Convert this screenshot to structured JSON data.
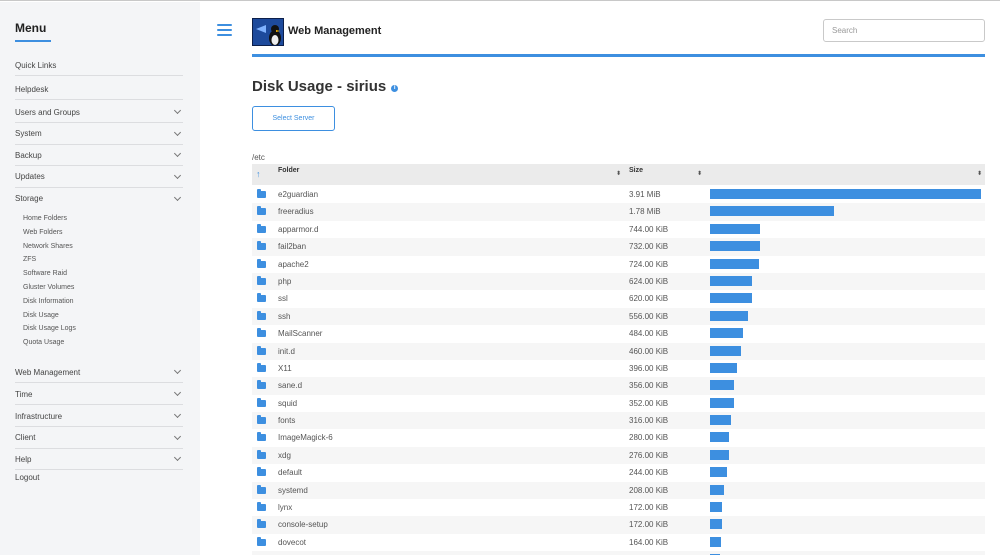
{
  "sidebar": {
    "title": "Menu",
    "items": [
      {
        "label": "Quick Links",
        "expandable": false
      },
      {
        "label": "Helpdesk",
        "expandable": false
      },
      {
        "label": "Users and Groups",
        "expandable": true
      },
      {
        "label": "System",
        "expandable": true
      },
      {
        "label": "Backup",
        "expandable": true
      },
      {
        "label": "Updates",
        "expandable": true
      },
      {
        "label": "Storage",
        "expandable": true
      }
    ],
    "storage_sub": [
      "Home Folders",
      "Web Folders",
      "Network Shares",
      "ZFS",
      "Software Raid",
      "Gluster Volumes",
      "Disk Information",
      "Disk Usage",
      "Disk Usage Logs",
      "Quota Usage"
    ],
    "items_after": [
      {
        "label": "Web Management",
        "expandable": true
      },
      {
        "label": "Time",
        "expandable": true
      },
      {
        "label": "Infrastructure",
        "expandable": true
      },
      {
        "label": "Client",
        "expandable": true
      },
      {
        "label": "Help",
        "expandable": true
      },
      {
        "label": "Logout",
        "expandable": false
      }
    ]
  },
  "header": {
    "brand": "Web Management",
    "search_placeholder": "Search"
  },
  "main": {
    "title": "Disk Usage - sirius",
    "info_icon": "i",
    "select_button": "Select Server",
    "path": "/etc",
    "columns": {
      "folder": "Folder",
      "size": "Size",
      "sort_icon": "↑",
      "sort_both": "⬍"
    },
    "bar_color": "#3d8fe0",
    "rows": [
      {
        "name": "e2guardian",
        "size": "3.91 MiB",
        "fraction": 1.0
      },
      {
        "name": "freeradius",
        "size": "1.78 MiB",
        "fraction": 0.456
      },
      {
        "name": "apparmor.d",
        "size": "744.00 KiB",
        "fraction": 0.186
      },
      {
        "name": "fail2ban",
        "size": "732.00 KiB",
        "fraction": 0.183
      },
      {
        "name": "apache2",
        "size": "724.00 KiB",
        "fraction": 0.181
      },
      {
        "name": "php",
        "size": "624.00 KiB",
        "fraction": 0.156
      },
      {
        "name": "ssl",
        "size": "620.00 KiB",
        "fraction": 0.155
      },
      {
        "name": "ssh",
        "size": "556.00 KiB",
        "fraction": 0.139
      },
      {
        "name": "MailScanner",
        "size": "484.00 KiB",
        "fraction": 0.121
      },
      {
        "name": "init.d",
        "size": "460.00 KiB",
        "fraction": 0.115
      },
      {
        "name": "X11",
        "size": "396.00 KiB",
        "fraction": 0.099
      },
      {
        "name": "sane.d",
        "size": "356.00 KiB",
        "fraction": 0.089
      },
      {
        "name": "squid",
        "size": "352.00 KiB",
        "fraction": 0.088
      },
      {
        "name": "fonts",
        "size": "316.00 KiB",
        "fraction": 0.079
      },
      {
        "name": "ImageMagick-6",
        "size": "280.00 KiB",
        "fraction": 0.07
      },
      {
        "name": "xdg",
        "size": "276.00 KiB",
        "fraction": 0.069
      },
      {
        "name": "default",
        "size": "244.00 KiB",
        "fraction": 0.061
      },
      {
        "name": "systemd",
        "size": "208.00 KiB",
        "fraction": 0.052
      },
      {
        "name": "lynx",
        "size": "172.00 KiB",
        "fraction": 0.043
      },
      {
        "name": "console-setup",
        "size": "172.00 KiB",
        "fraction": 0.043
      },
      {
        "name": "dovecot",
        "size": "164.00 KiB",
        "fraction": 0.041
      },
      {
        "name": "",
        "size": "",
        "fraction": 0.038
      }
    ]
  }
}
